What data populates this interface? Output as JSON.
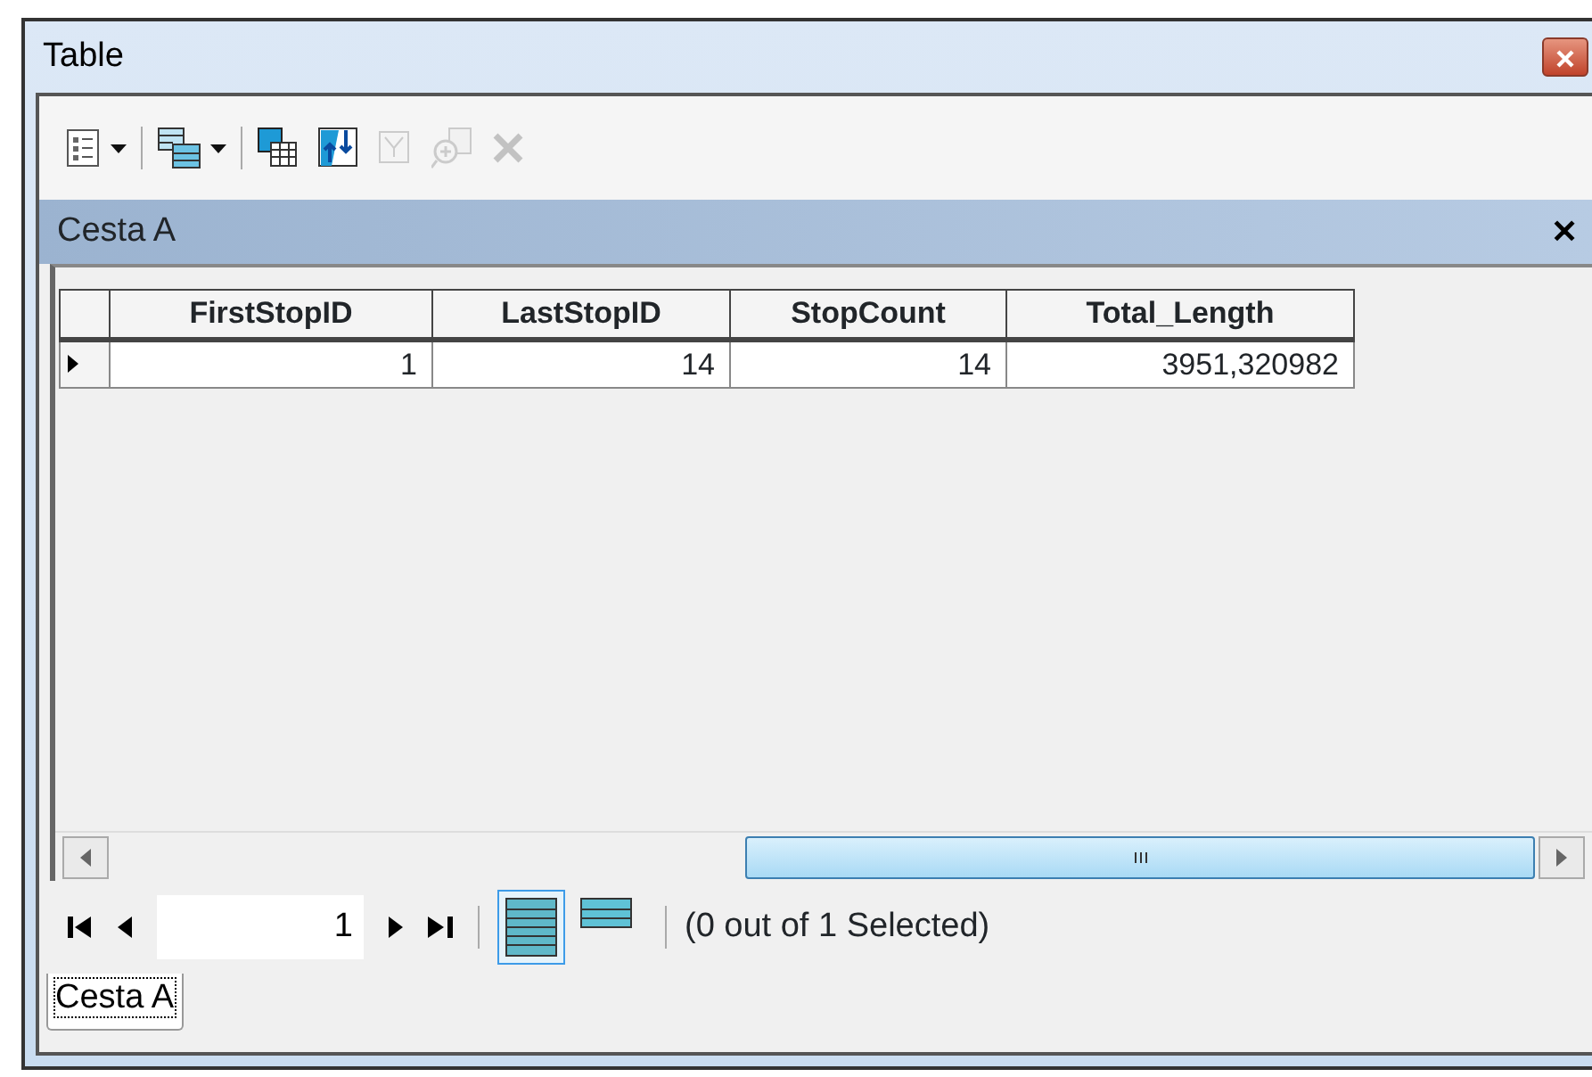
{
  "window": {
    "title": "Table"
  },
  "toolbar": [
    {
      "kind": "options",
      "disabled": false,
      "dropdown": true
    },
    {
      "kind": "related",
      "disabled": false,
      "dropdown": true
    },
    {
      "kind": "select-by",
      "disabled": false,
      "dropdown": false
    },
    {
      "kind": "switch",
      "disabled": false,
      "dropdown": false
    },
    {
      "kind": "clear",
      "disabled": true,
      "dropdown": false
    },
    {
      "kind": "zoom",
      "disabled": true,
      "dropdown": false
    },
    {
      "kind": "delete",
      "disabled": true,
      "dropdown": false
    }
  ],
  "panel": {
    "title": "Cesta A",
    "close": "✕"
  },
  "table": {
    "columns": [
      "FirstStopID",
      "LastStopID",
      "StopCount",
      "Total_Length"
    ],
    "rows": [
      {
        "current": true,
        "cells": [
          "1",
          "14",
          "14",
          "3951,320982"
        ]
      }
    ]
  },
  "pager": {
    "page": "1",
    "views": [
      {
        "kind": "all",
        "selected": true
      },
      {
        "kind": "selected",
        "selected": false
      }
    ],
    "status": "(0 out of 1 Selected)"
  },
  "tabs": [
    {
      "label": "Cesta A",
      "selected": true
    }
  ]
}
